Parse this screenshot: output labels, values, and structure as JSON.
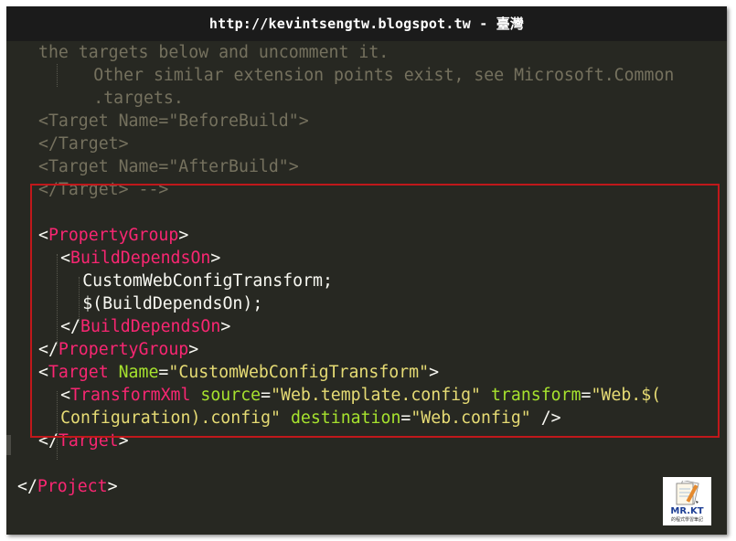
{
  "watermark": {
    "text": "http://kevintsengtw.blogspot.tw - 臺灣"
  },
  "code_lines": [
    {
      "indent": 1,
      "tokens": [
        {
          "t": "the targets below and uncomment it.",
          "c": "dim"
        }
      ]
    },
    {
      "indent": 3.5,
      "tokens": [
        {
          "t": "Other similar extension points exist, see Microsoft.Common",
          "c": "dim"
        }
      ]
    },
    {
      "indent": 3.5,
      "tokens": [
        {
          "t": ".targets.",
          "c": "dim"
        }
      ]
    },
    {
      "indent": 1,
      "tokens": [
        {
          "t": "<Target Name=\"BeforeBuild\">",
          "c": "dim"
        }
      ]
    },
    {
      "indent": 1,
      "tokens": [
        {
          "t": "</Target>",
          "c": "dim"
        }
      ]
    },
    {
      "indent": 1,
      "tokens": [
        {
          "t": "<Target Name=\"AfterBuild\">",
          "c": "dim"
        }
      ]
    },
    {
      "indent": 1,
      "tokens": [
        {
          "t": "</Target> -->",
          "c": "dim"
        }
      ]
    },
    {
      "indent": 1,
      "tokens": []
    },
    {
      "indent": 1,
      "tokens": [
        {
          "t": "<",
          "c": "bright"
        },
        {
          "t": "PropertyGroup",
          "c": "tag"
        },
        {
          "t": ">",
          "c": "bright"
        }
      ]
    },
    {
      "indent": 2,
      "tokens": [
        {
          "t": "<",
          "c": "bright"
        },
        {
          "t": "BuildDependsOn",
          "c": "tag"
        },
        {
          "t": ">",
          "c": "bright"
        }
      ]
    },
    {
      "indent": 3,
      "tokens": [
        {
          "t": "CustomWebConfigTransform;",
          "c": "bright"
        }
      ]
    },
    {
      "indent": 3,
      "tokens": [
        {
          "t": "$(BuildDependsOn);",
          "c": "bright"
        }
      ]
    },
    {
      "indent": 2,
      "tokens": [
        {
          "t": "</",
          "c": "bright"
        },
        {
          "t": "BuildDependsOn",
          "c": "tag"
        },
        {
          "t": ">",
          "c": "bright"
        }
      ]
    },
    {
      "indent": 1,
      "tokens": [
        {
          "t": "</",
          "c": "bright"
        },
        {
          "t": "PropertyGroup",
          "c": "tag"
        },
        {
          "t": ">",
          "c": "bright"
        }
      ]
    },
    {
      "indent": 1,
      "tokens": [
        {
          "t": "<",
          "c": "bright"
        },
        {
          "t": "Target",
          "c": "tag"
        },
        {
          "t": " ",
          "c": "bright"
        },
        {
          "t": "Name",
          "c": "attr"
        },
        {
          "t": "=",
          "c": "bright"
        },
        {
          "t": "\"CustomWebConfigTransform\"",
          "c": "str"
        },
        {
          "t": ">",
          "c": "bright"
        }
      ]
    },
    {
      "indent": 2,
      "tokens": [
        {
          "t": "<",
          "c": "bright"
        },
        {
          "t": "TransformXml",
          "c": "tag"
        },
        {
          "t": " ",
          "c": "bright"
        },
        {
          "t": "source",
          "c": "attr"
        },
        {
          "t": "=",
          "c": "bright"
        },
        {
          "t": "\"Web.template.config\"",
          "c": "str"
        },
        {
          "t": " ",
          "c": "bright"
        },
        {
          "t": "transform",
          "c": "attr"
        },
        {
          "t": "=",
          "c": "bright"
        },
        {
          "t": "\"Web.$(",
          "c": "str"
        }
      ]
    },
    {
      "indent": 2,
      "tokens": [
        {
          "t": "Configuration).config\"",
          "c": "str"
        },
        {
          "t": " ",
          "c": "bright"
        },
        {
          "t": "destination",
          "c": "attr"
        },
        {
          "t": "=",
          "c": "bright"
        },
        {
          "t": "\"Web.config\"",
          "c": "str"
        },
        {
          "t": " />",
          "c": "bright"
        }
      ]
    },
    {
      "indent": 1,
      "tokens": [
        {
          "t": "</",
          "c": "bright"
        },
        {
          "t": "Target",
          "c": "tag"
        },
        {
          "t": ">",
          "c": "bright"
        }
      ]
    },
    {
      "indent": 1,
      "tokens": []
    },
    {
      "indent": 0,
      "tokens": [
        {
          "t": "</",
          "c": "bright"
        },
        {
          "t": "Project",
          "c": "tag"
        },
        {
          "t": ">",
          "c": "bright"
        }
      ]
    }
  ],
  "logo": {
    "title": "MR.KT",
    "subtitle": "的程式學習筆記"
  },
  "colors": {
    "background": "#272822",
    "comment": "#75715e",
    "text": "#f8f8f2",
    "tag": "#f92672",
    "attribute": "#a6e22e",
    "string": "#e6db74",
    "highlight_border": "#c0181b"
  }
}
